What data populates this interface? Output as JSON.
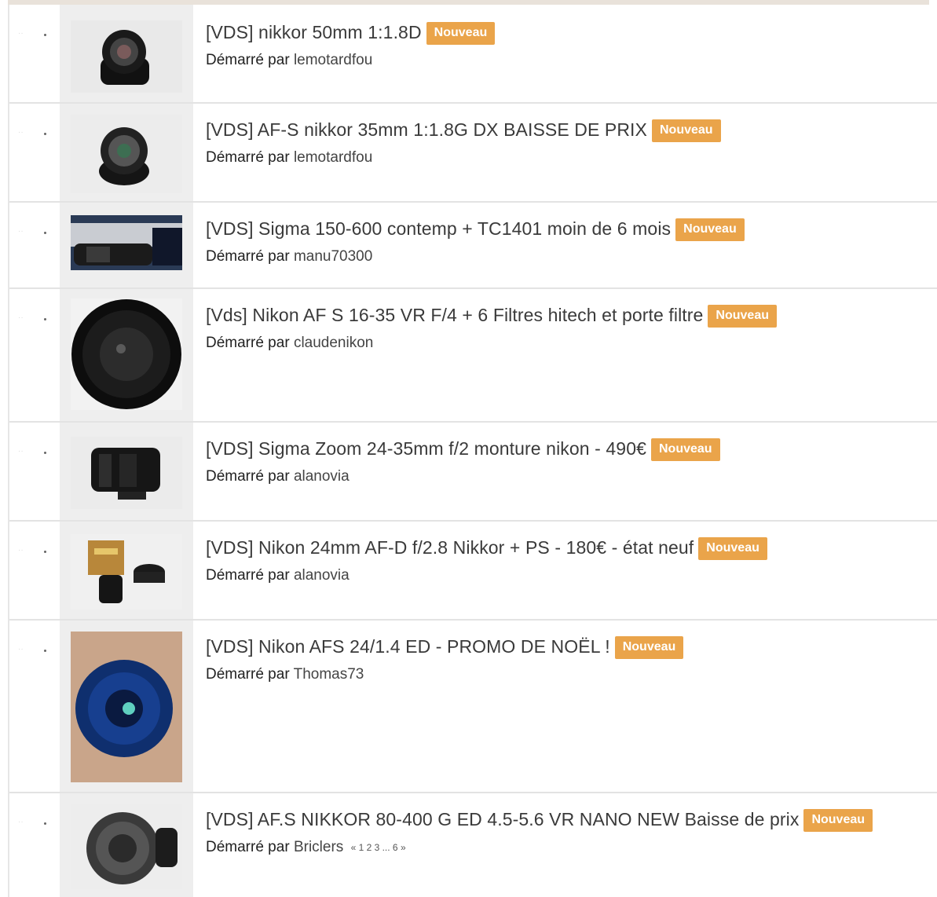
{
  "badge_label": "Nouveau",
  "started_by_label": "Démarré par",
  "colors": {
    "badge": "#eaa44a",
    "thumb_cell": "#eeeeee",
    "divider": "#e3e3e3"
  },
  "topics": [
    {
      "title": "[VDS] nikkor 50mm 1:1.8D",
      "author": "lemotardfou",
      "thumb": "lens-icon"
    },
    {
      "title": "[VDS] AF-S nikkor 35mm 1:1.8G DX BAISSE DE PRIX",
      "author": "lemotardfou",
      "thumb": "lens-icon"
    },
    {
      "title": "[VDS] Sigma 150-600 contemp + TC1401 moin de 6 mois",
      "author": "manu70300",
      "thumb": "lens-kit-icon"
    },
    {
      "title": "[Vds] Nikon AF S 16-35 VR F/4 + 6 Filtres hitech et porte filtre",
      "author": "claudenikon",
      "thumb": "lens-front-icon"
    },
    {
      "title": "[VDS] Sigma Zoom 24-35mm f/2 monture nikon - 490€",
      "author": "alanovia",
      "thumb": "lens-side-icon"
    },
    {
      "title": "[VDS] Nikon 24mm AF-D f/2.8 Nikkor + PS - 180€ - état neuf",
      "author": "alanovia",
      "thumb": "lens-box-icon"
    },
    {
      "title": "[VDS] Nikon AFS 24/1.4 ED - PROMO DE NOËL !",
      "author": "Thomas73",
      "thumb": "lens-blue-icon"
    },
    {
      "title": "[VDS] AF.S NIKKOR 80-400 G ED 4.5-5.6 VR NANO NEW Baisse de prix",
      "author": "Briclers",
      "thumb": "lens-zoom-icon",
      "pager": "« 1 2 3 ... 6 »"
    }
  ]
}
